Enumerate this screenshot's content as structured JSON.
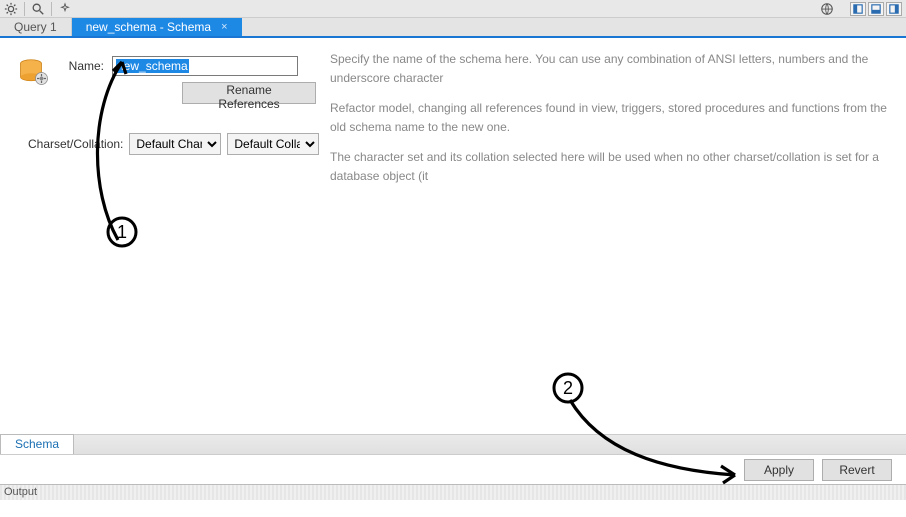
{
  "toolbar": {
    "icons": [
      "gear",
      "zoom",
      "refresh"
    ]
  },
  "tabs": [
    {
      "label": "Query 1",
      "active": false
    },
    {
      "label": "new_schema - Schema",
      "active": true
    }
  ],
  "form": {
    "name_label": "Name:",
    "name_value": "new_schema",
    "rename_button": "Rename References",
    "charset_label": "Charset/Collation:",
    "charset_value": "Default Charset",
    "collation_value": "Default Collation"
  },
  "descriptions": {
    "line1": "Specify the name of the schema here. You can use any combination of ANSI letters, numbers and the underscore character",
    "line2": "Refactor model, changing all references found in view, triggers, stored procedures and functions from the old schema name to the new one.",
    "line3": "The character set and its collation selected here will be used when no other charset/collation is set for a database object (it"
  },
  "bottom_tab": "Schema",
  "actions": {
    "apply": "Apply",
    "revert": "Revert"
  },
  "output_label": "Output",
  "annotations": {
    "step1": "1",
    "step2": "2"
  }
}
